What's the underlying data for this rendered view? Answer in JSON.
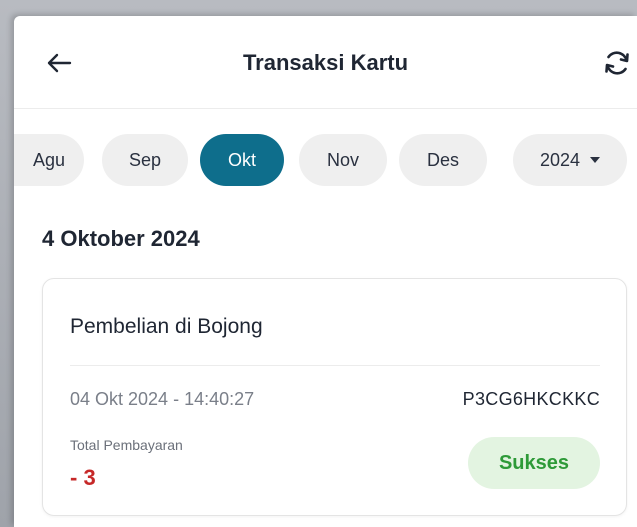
{
  "header": {
    "title": "Transaksi Kartu",
    "back_icon": "arrow-left-icon",
    "refresh_icon": "refresh-icon"
  },
  "months": [
    {
      "label": "Agu",
      "active": false
    },
    {
      "label": "Sep",
      "active": false
    },
    {
      "label": "Okt",
      "active": true
    },
    {
      "label": "Nov",
      "active": false
    },
    {
      "label": "Des",
      "active": false
    }
  ],
  "year_select": {
    "value": "2024",
    "icon": "caret-down-icon"
  },
  "section": {
    "date": "4 Oktober 2024"
  },
  "transaction": {
    "title": "Pembelian di Bojong",
    "datetime": "04 Okt 2024 - 14:40:27",
    "reference": "P3CG6HKCKKC",
    "total_label": "Total Pembayaran",
    "amount": "- 3",
    "status": "Sukses"
  },
  "colors": {
    "accent": "#0e6e8c",
    "amount_negative": "#c62828",
    "status_success_text": "#2e9a38",
    "status_success_bg": "#e3f4e1",
    "chip_bg": "#efefef"
  }
}
